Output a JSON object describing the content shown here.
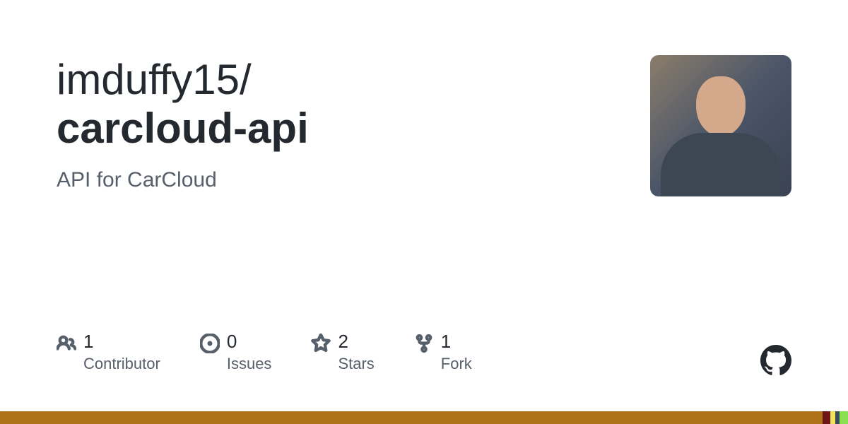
{
  "repo": {
    "owner": "imduffy15",
    "separator": "/",
    "name": "carcloud-api",
    "description": "API for CarCloud"
  },
  "stats": [
    {
      "count": "1",
      "label": "Contributor"
    },
    {
      "count": "0",
      "label": "Issues"
    },
    {
      "count": "2",
      "label": "Stars"
    },
    {
      "count": "1",
      "label": "Fork"
    }
  ],
  "language_bar": {
    "segments": [
      {
        "color": "#b07219",
        "width": "97%"
      },
      {
        "color": "#701516",
        "width": "0.9%"
      },
      {
        "color": "#f1e05a",
        "width": "0.6%"
      },
      {
        "color": "#384d54",
        "width": "0.5%"
      },
      {
        "color": "#89e051",
        "width": "1%"
      }
    ]
  }
}
